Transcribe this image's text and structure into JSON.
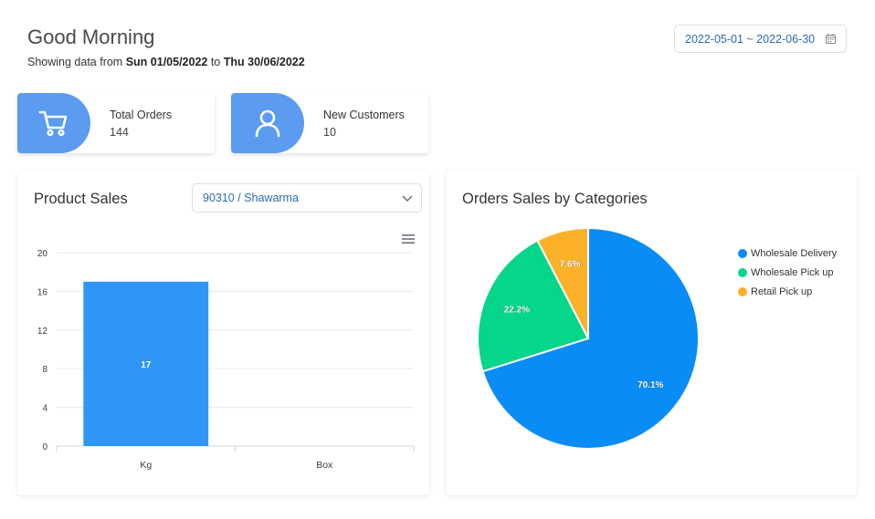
{
  "header": {
    "greeting": "Good Morning",
    "showing_prefix": "Showing data from ",
    "date_from": "Sun 01/05/2022",
    "to_word": " to ",
    "date_to": "Thu 30/06/2022"
  },
  "date_range": {
    "value": "2022-05-01 ~ 2022-06-30",
    "icon": "calendar-icon"
  },
  "stats": [
    {
      "label": "Total Orders",
      "value": "144",
      "icon": "cart-icon"
    },
    {
      "label": "New Customers",
      "value": "10",
      "icon": "user-icon"
    }
  ],
  "colors": {
    "accent": "#5b9bf0",
    "bar": "#2e96f6",
    "pie": [
      "#0a8cf7",
      "#06d68a",
      "#fbb128"
    ]
  },
  "product_sales": {
    "title": "Product Sales",
    "select_value": "90310 / Shawarma",
    "menu_icon": "hamburger-icon"
  },
  "orders_sales": {
    "title": "Orders Sales by Categories"
  },
  "chart_data": [
    {
      "type": "bar",
      "title": "Product Sales",
      "categories": [
        "Kg",
        "Box"
      ],
      "values": [
        17,
        0
      ],
      "ylim": [
        0,
        20
      ],
      "yticks": [
        0,
        4,
        8,
        12,
        16,
        20
      ],
      "data_labels": [
        "17",
        ""
      ],
      "grid": true,
      "xlabel": "",
      "ylabel": ""
    },
    {
      "type": "pie",
      "title": "Orders Sales by Categories",
      "categories": [
        "Wholesale Delivery",
        "Wholesale Pick up",
        "Retail Pick up"
      ],
      "values": [
        70.1,
        22.2,
        7.6
      ],
      "data_labels": [
        "70.1%",
        "22.2%",
        "7.6%"
      ],
      "legend": "right"
    }
  ]
}
